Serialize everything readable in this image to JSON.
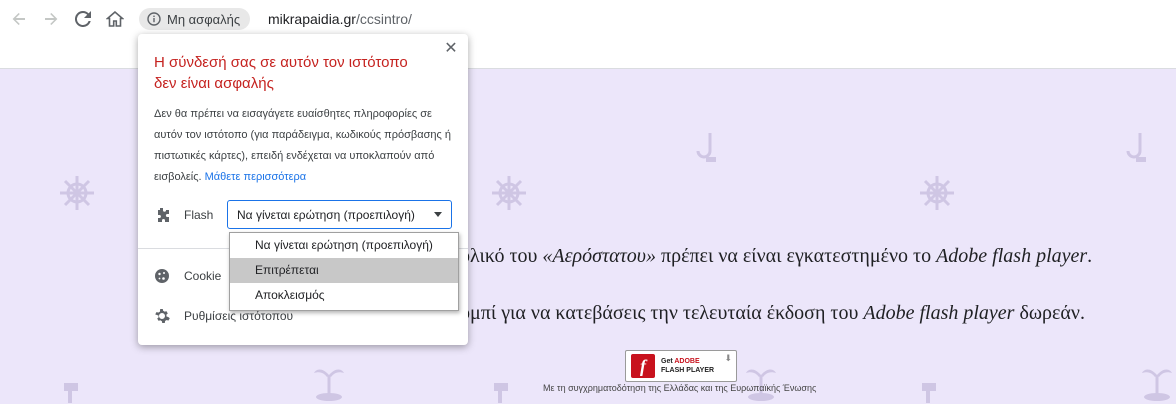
{
  "browser": {
    "security_chip": "Μη ασφαλής",
    "url_domain": "mikrapaidia.gr",
    "url_path": "/ccsintro/"
  },
  "page": {
    "line1_a": "ολικό του ",
    "line1_b": "«Αερόστατου»",
    "line1_c": " πρέπει να είναι εγκατεστημένο το ",
    "line1_d": "Adobe flash player",
    "line1_e": ".",
    "line2_a": "ομπί για να κατεβάσεις την τελευταία έκδοση του ",
    "line2_b": "Adobe flash player",
    "line2_c": " δωρεάν.",
    "flash_badge": {
      "get": "Get",
      "adobe": "ADOBE",
      "product": "FLASH",
      "product2": "PLAYER"
    },
    "footer": "Με τη συγχρηματοδότηση της Ελλάδας και της Ευρωπαϊκής Ένωσης"
  },
  "popup": {
    "title": "Η σύνδεσή σας σε αυτόν τον ιστότοπο δεν είναι ασφαλής",
    "description": "Δεν θα πρέπει να εισαγάγετε ευαίσθητες πληροφορίες σε αυτόν τον ιστότοπο (για παράδειγμα, κωδικούς πρόσβασης ή πιστωτικές κάρτες), επειδή ενδέχεται να υποκλαπούν από εισβολείς.",
    "learn_more": "Μάθετε περισσότερα",
    "flash_label": "Flash",
    "flash_select_value": "Να γίνεται ερώτηση (προεπιλογή)",
    "cookies_label": "Cookie",
    "site_settings_label": "Ρυθμίσεις ιστότοπου"
  },
  "dropdown": {
    "options": [
      "Να γίνεται ερώτηση (προεπιλογή)",
      "Επιτρέπεται",
      "Αποκλεισμός"
    ],
    "highlighted_index": 1
  }
}
